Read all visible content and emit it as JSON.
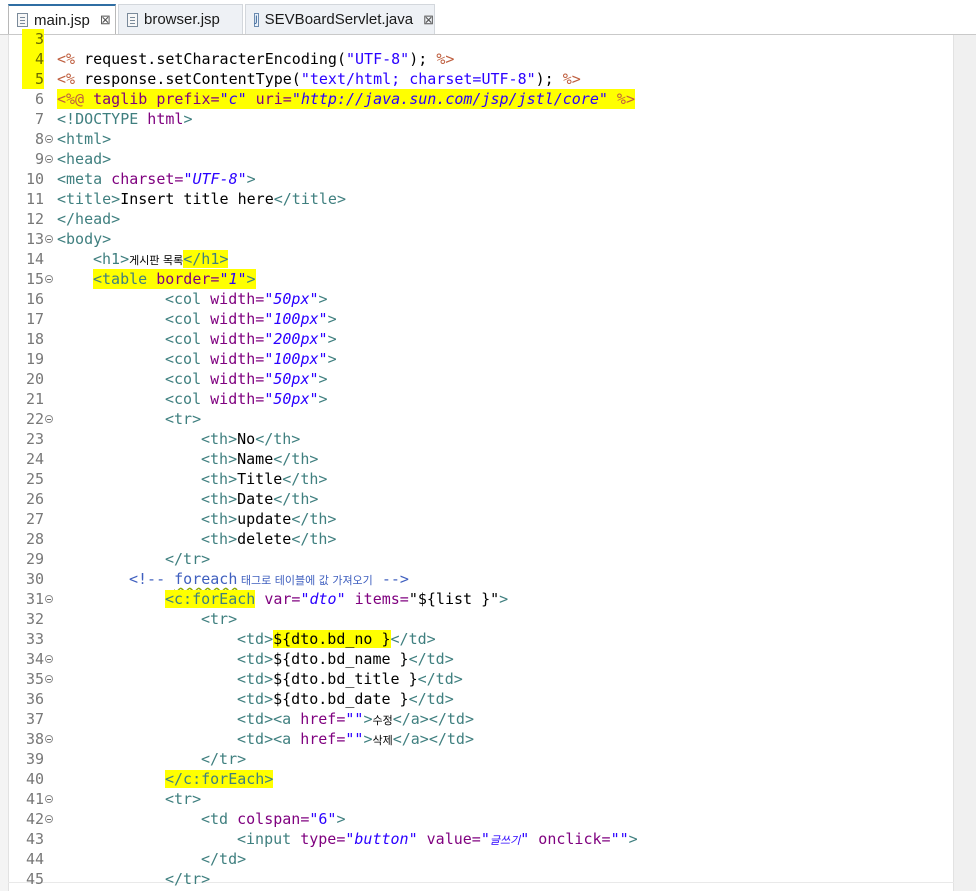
{
  "tabs": [
    {
      "label": "main.jsp",
      "active": true,
      "close": "⊠"
    },
    {
      "label": "browser.jsp",
      "active": false
    },
    {
      "label": "SEVBoardServlet.java",
      "active": false,
      "close": "⊠"
    }
  ],
  "line_numbers": [
    "3",
    "4",
    "5",
    "6",
    "7",
    "8",
    "9",
    "10",
    "11",
    "12",
    "13",
    "14",
    "15",
    "16",
    "17",
    "18",
    "19",
    "20",
    "21",
    "22",
    "23",
    "24",
    "25",
    "26",
    "27",
    "28",
    "29",
    "30",
    "31",
    "32",
    "33",
    "34",
    "35",
    "36",
    "37",
    "38",
    "39",
    "40",
    "41",
    "42",
    "43",
    "44",
    "45"
  ],
  "code": {
    "l4": {
      "open": "<%",
      "body": " request.setCharacterEncoding(",
      "str": "\"UTF-8\"",
      "end": "); ",
      "close": "%>"
    },
    "l5": {
      "open": "<%",
      "body": " response.setContentType(",
      "str": "\"text/html; charset=UTF-8\"",
      "end": "); ",
      "close": "%>"
    },
    "l6": {
      "open": "<%@",
      "kw": " taglib ",
      "a1": "prefix=",
      "v1": "\"c\"",
      "a2": " uri=",
      "v2": "\"http://java.sun.com/jsp/jstl/core\"",
      "close": " %>"
    },
    "l7": {
      "lt": "<!",
      "name": "DOCTYPE",
      "rest": " html",
      "gt": ">"
    },
    "l8": "<html>",
    "l9": "<head>",
    "l10": {
      "tag": "<meta",
      "attr": " charset=",
      "val": "\"UTF-8\"",
      "gt": ">"
    },
    "l11": {
      "open": "<title>",
      "text": "Insert title here",
      "close": "</title>"
    },
    "l12": "</head>",
    "l13": "<body>",
    "l14": {
      "open": "<h1>",
      "text": "게시판 목록",
      "close": "</h1>"
    },
    "l15": {
      "tag": "<table",
      "attr": " border=",
      "val": "\"1\"",
      "gt": ">"
    },
    "cols": [
      "\"50px\"",
      "\"100px\"",
      "\"200px\"",
      "\"100px\"",
      "\"50px\"",
      "\"50px\""
    ],
    "col_tag": "<col",
    "width_attr": " width=",
    "tr_open": "<tr>",
    "tr_close": "</tr>",
    "th_open": "<th>",
    "th_close": "</th>",
    "headers": [
      "No",
      "Name",
      "Title",
      "Date",
      "update",
      "delete"
    ],
    "l30": {
      "open": "<!-- ",
      "word": "foreach",
      "kr": " 태그로 테이블에 값 가져오기",
      "close": " -->"
    },
    "l31": {
      "tag": "<c:forEach",
      "a1": " var=",
      "v1": "\"dto\"",
      "a2": " items=",
      "v2": "\"${list }\"",
      "gt": ">"
    },
    "td_open": "<td>",
    "td_close": "</td>",
    "cells": [
      "${dto.bd_no }",
      "${dto.bd_name }",
      "${dto.bd_title }",
      "${dto.bd_date }"
    ],
    "link_tag": "<a",
    "href_attr": " href=",
    "href_val": "\"\"",
    "gt": ">",
    "a_close": "</a>",
    "links": [
      "수정",
      "삭제"
    ],
    "l40": "</c:forEach>",
    "l42": {
      "tag": "<td",
      "attr": " colspan=",
      "val": "\"6\"",
      "gt": ">"
    },
    "l43": {
      "tag": "<input",
      "a1": " type=",
      "v1": "\"button\"",
      "a2": " value=",
      "v2q": "\"",
      "v2": "글쓰기",
      "v2q2": "\"",
      "a3": " onclick=",
      "v3": "\"\"",
      "gt": ">"
    }
  },
  "colors": {
    "tag": "#3f7f7f",
    "attribute": "#7f007f",
    "value": "#2a00ff",
    "comment": "#3f5fbf",
    "highlight": "#ffff00",
    "active_tab": "#2f6ea3"
  }
}
